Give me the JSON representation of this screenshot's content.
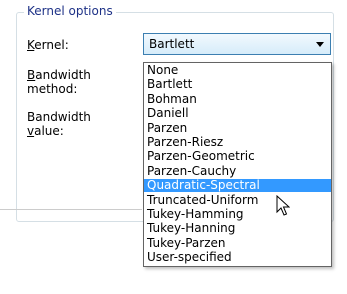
{
  "group": {
    "title": "Kernel options"
  },
  "labels": {
    "kernel": "Kernel:",
    "bandwidth_method_1": "Bandwidth",
    "bandwidth_method_2": "method:",
    "bandwidth_value_1": "Bandwidth",
    "bandwidth_value_2": "value:"
  },
  "kernel_combo": {
    "value": "Bartlett"
  },
  "dropdown": {
    "selected_index": 9,
    "options": [
      "None",
      "Bartlett",
      "Bohman",
      "Daniell",
      "Parzen",
      "Parzen-Riesz",
      "Parzen-Geometric",
      "Parzen-Cauchy",
      "Quadratic-Spectral",
      "Truncated-Uniform",
      "Tukey-Hamming",
      "Tukey-Hanning",
      "Tukey-Parzen",
      "User-specified"
    ]
  },
  "icons": {
    "cursor": "arrow-cursor-icon",
    "dropdown_arrow": "chevron-down-icon"
  },
  "colors": {
    "selection": "#3399ff",
    "group_title": "#1e3287"
  }
}
